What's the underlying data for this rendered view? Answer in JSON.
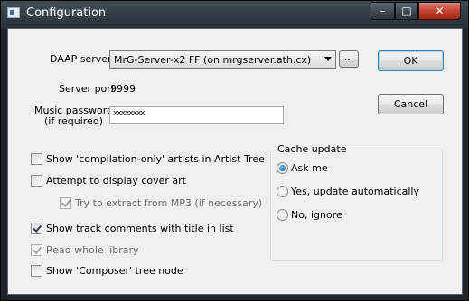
{
  "window": {
    "title": "Configuration",
    "caption": {
      "minimize": "–",
      "maximize": "□",
      "close": "✕"
    }
  },
  "server": {
    "label": "DAAP server",
    "value": "MrG-Server-x2 FF (on mrgserver.ath.cx)",
    "browse_label": "..."
  },
  "port": {
    "label": "Server port",
    "value": "9999"
  },
  "password": {
    "label_line1": "Music password",
    "label_line2": "(if required)",
    "value": "xxxxxxxx"
  },
  "buttons": {
    "ok": "OK",
    "cancel": "Cancel"
  },
  "options": [
    {
      "label": "Show 'compilation-only' artists in Artist Tree",
      "checked": false,
      "enabled": true
    },
    {
      "label": "Attempt to display cover art",
      "checked": false,
      "enabled": true
    },
    {
      "label": "Try to extract from MP3 (if necessary)",
      "checked": true,
      "enabled": false
    },
    {
      "label": "Show track comments with title in list",
      "checked": true,
      "enabled": true
    },
    {
      "label": "Read whole library",
      "checked": true,
      "enabled": false
    },
    {
      "label": "Show 'Composer' tree node",
      "checked": false,
      "enabled": true
    }
  ],
  "cache_update": {
    "title": "Cache update",
    "choices": [
      {
        "label": "Ask me",
        "selected": true
      },
      {
        "label": "Yes, update automatically",
        "selected": false
      },
      {
        "label": "No, ignore",
        "selected": false
      }
    ]
  }
}
